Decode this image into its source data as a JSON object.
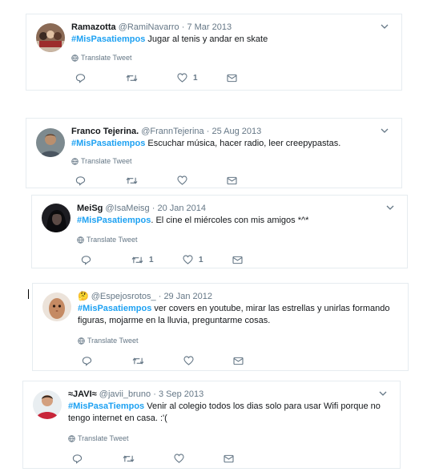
{
  "translate_label": "Translate Tweet",
  "colors": {
    "link": "#1da1f2",
    "muted": "#657786",
    "border": "#e6ecf0"
  },
  "tweets": [
    {
      "name": "Ramazotta",
      "handle": "@RamiNavarro",
      "separator": "·",
      "date": "7 Mar 2013",
      "hashtag": "#MisPasatiempos",
      "text": " Jugar al tenis y andar en skate",
      "likes": "1",
      "retweets": "",
      "avatar_icon": "group-photo-avatar"
    },
    {
      "name": "Franco Tejerina.",
      "handle": "@FrannTejerina",
      "separator": "·",
      "date": "25 Aug 2013",
      "hashtag": "#MisPasatiempos",
      "text": " Escuchar música, hacer radio, leer creepypastas.",
      "likes": "",
      "retweets": "",
      "avatar_icon": "person-photo-avatar"
    },
    {
      "name": "MeiSg",
      "handle": "@IsaMeisg",
      "separator": "·",
      "date": "20 Jan 2014",
      "hashtag": "#MisPasatiempos",
      "text": ". El cine el miércoles con mis amigos *^*",
      "likes": "1",
      "retweets": "1",
      "avatar_icon": "dark-photo-avatar"
    },
    {
      "name": "",
      "name_emoji": "🤔",
      "handle": "@Espejosrotos_",
      "separator": "·",
      "date": "29 Jan 2012",
      "hashtag": "#MisPasatiempos",
      "text": " ver covers en youtube, mirar las estrellas y unirlas formando",
      "text2": "figuras, mojarme en la lluvia, preguntarme cosas.",
      "likes": "",
      "retweets": "",
      "avatar_icon": "potato-avatar"
    },
    {
      "name": "≈JAVI≈",
      "handle": "@javii_bruno",
      "separator": "·",
      "date": "3 Sep 2013",
      "hashtag": "#MisPasaTiempos",
      "text": " Venir al colegio todos los dias solo para usar Wifi porque no",
      "text2": "tengo internet en casa. :'(",
      "likes": "",
      "retweets": "",
      "avatar_icon": "person-red-shirt-avatar"
    }
  ]
}
